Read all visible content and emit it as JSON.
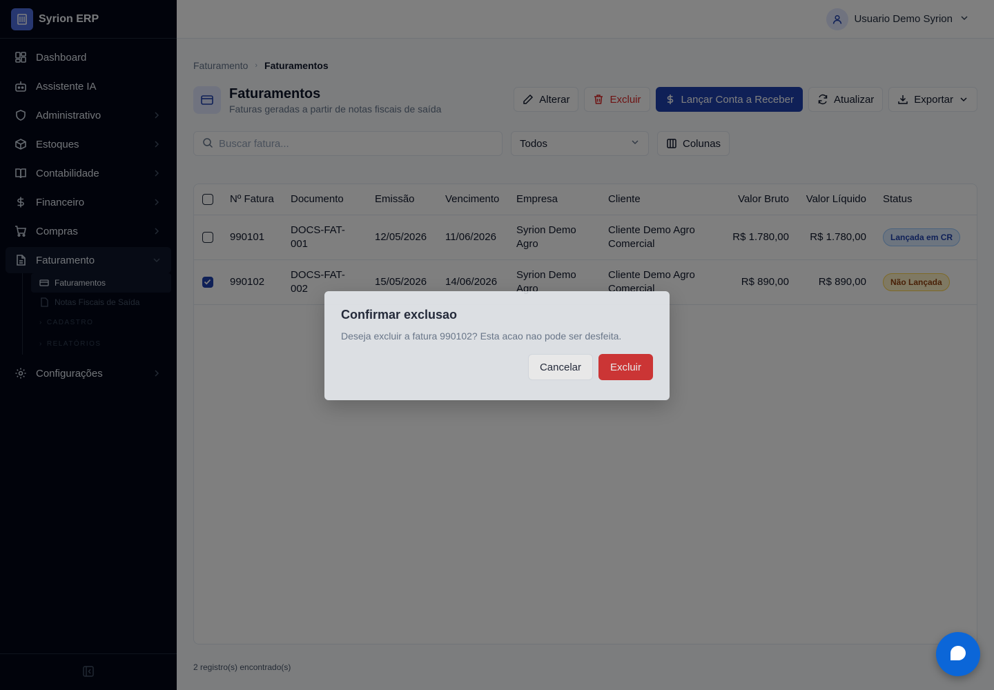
{
  "app": {
    "name": "Syrion ERP"
  },
  "user": {
    "name": "Usuario Demo Syrion"
  },
  "sidebar": {
    "items": [
      {
        "label": "Dashboard",
        "icon": "dashboard-icon"
      },
      {
        "label": "Assistente IA",
        "icon": "robot-icon"
      },
      {
        "label": "Administrativo",
        "icon": "shield-icon"
      },
      {
        "label": "Estoques",
        "icon": "package-icon"
      },
      {
        "label": "Contabilidade",
        "icon": "book-icon"
      },
      {
        "label": "Financeiro",
        "icon": "dollar-icon"
      },
      {
        "label": "Compras",
        "icon": "cart-icon"
      },
      {
        "label": "Faturamento",
        "icon": "document-icon"
      },
      {
        "label": "Configurações",
        "icon": "gear-icon"
      }
    ],
    "faturamento_sub": {
      "item1": "Faturamentos",
      "item2": "Notas Fiscais de Saída",
      "section1": "CADASTRO",
      "section2": "RELATÓRIOS"
    }
  },
  "breadcrumb": {
    "parent": "Faturamento",
    "current": "Faturamentos"
  },
  "page": {
    "title": "Faturamentos",
    "subtitle": "Faturas geradas a partir de notas fiscais de saída"
  },
  "toolbar": {
    "edit": "Alterar",
    "delete": "Excluir",
    "receivable": "Lançar Conta a Receber",
    "refresh": "Atualizar",
    "export": "Exportar"
  },
  "filters": {
    "search_placeholder": "Buscar fatura...",
    "status_selected": "Todos",
    "columns_label": "Colunas"
  },
  "table": {
    "headers": {
      "number": "Nº Fatura",
      "document": "Documento",
      "issue": "Emissão",
      "due": "Vencimento",
      "company": "Empresa",
      "client": "Cliente",
      "gross": "Valor Bruto",
      "net": "Valor Líquido",
      "status": "Status"
    },
    "rows": [
      {
        "number": "990101",
        "document": "DOCS-FAT-001",
        "issue": "12/05/2026",
        "due": "11/06/2026",
        "company": "Syrion Demo Agro",
        "client": "Cliente Demo Agro Comercial",
        "gross": "R$ 1.780,00",
        "net": "R$ 1.780,00",
        "status": "Lançada em CR",
        "checked": false
      },
      {
        "number": "990102",
        "document": "DOCS-FAT-002",
        "issue": "15/05/2026",
        "due": "14/06/2026",
        "company": "Syrion Demo Agro",
        "client": "Cliente Demo Agro Comercial",
        "gross": "R$ 890,00",
        "net": "R$ 890,00",
        "status": "Não Lançada",
        "checked": true
      }
    ]
  },
  "footer": {
    "count": "2 registro(s) encontrado(s)"
  },
  "dialog": {
    "title": "Confirmar exclusao",
    "message": "Deseja excluir a fatura 990102? Esta acao nao pode ser desfeita.",
    "cancel": "Cancelar",
    "confirm": "Excluir"
  },
  "colors": {
    "sidebar_bg": "#020617",
    "primary": "#1e40af",
    "danger": "#dc2626",
    "chat": "#0b66d8"
  }
}
